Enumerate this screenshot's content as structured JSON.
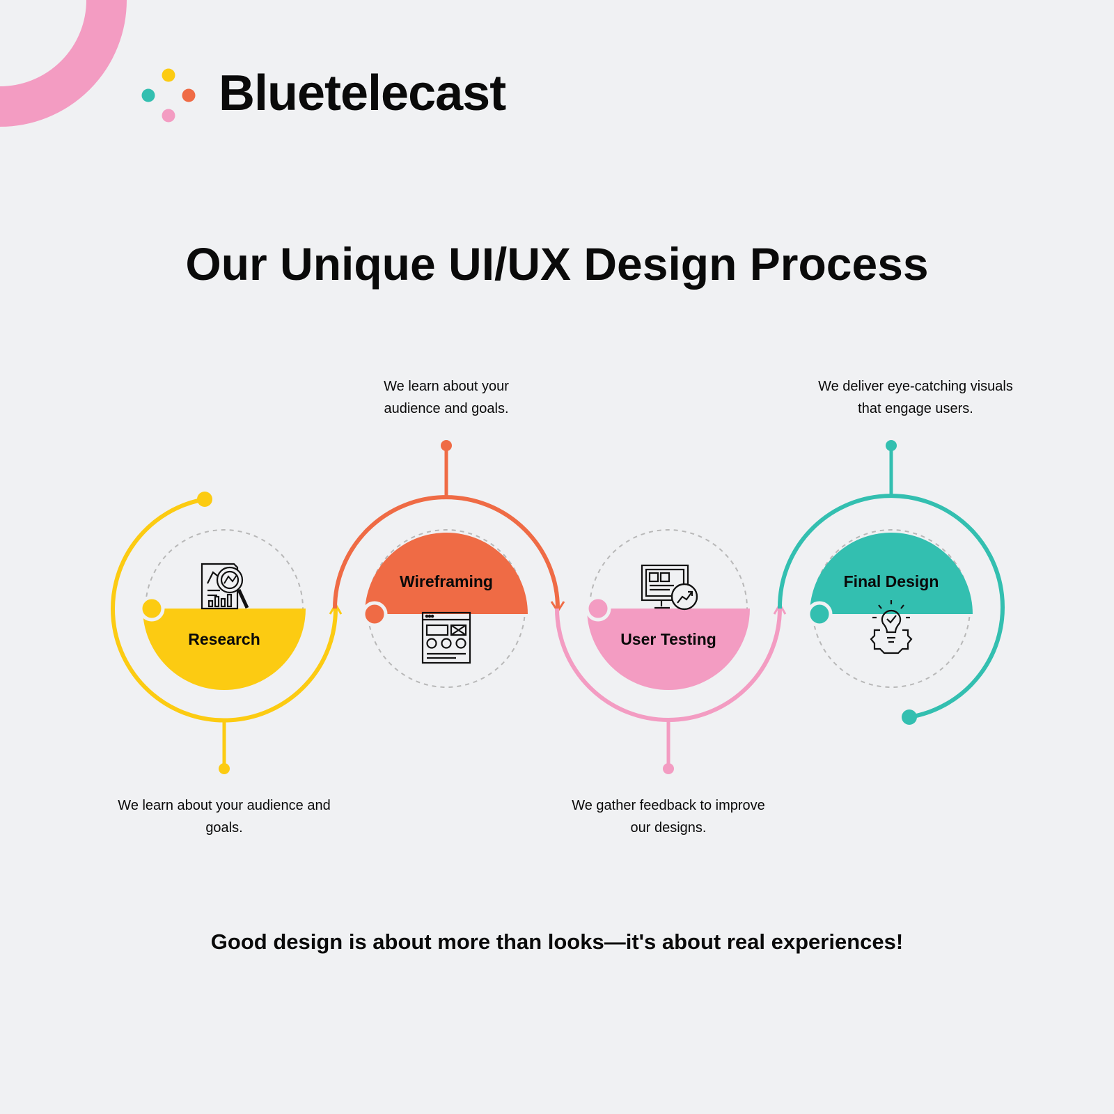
{
  "brand": {
    "name": "Bluetelecast",
    "colors": {
      "yellow": "#fccb12",
      "orange": "#ef6b45",
      "pink": "#f39cc2",
      "teal": "#33bfb0"
    }
  },
  "title": "Our Unique UI/UX Design Process",
  "steps": [
    {
      "label": "Research",
      "description": "We learn about your audience and goals.",
      "color": "#fccb12",
      "icon": "research-chart-magnifier-icon"
    },
    {
      "label": "Wireframing",
      "description": "We learn about your audience and goals.",
      "color": "#ef6b45",
      "icon": "wireframe-layout-icon"
    },
    {
      "label": "User Testing",
      "description": "We gather feedback to improve our designs.",
      "color": "#f39cc2",
      "icon": "monitor-analytics-icon"
    },
    {
      "label": "Final Design",
      "description": "We deliver eye-catching visuals that engage users.",
      "color": "#33bfb0",
      "icon": "lightbulb-gear-icon"
    }
  ],
  "tagline": "Good design is about more than looks—it's about real experiences!"
}
